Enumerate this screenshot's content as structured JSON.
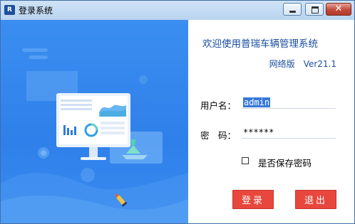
{
  "window": {
    "title": "登录系统",
    "icon_glyph": "R",
    "close_glyph": "✕"
  },
  "header": {
    "welcome": "欢迎使用普瑞车辆管理系统",
    "edition": "网络版",
    "version": "Ver21.1"
  },
  "form": {
    "username_label": "用户名：",
    "username_value": "admin",
    "password_label": "密　码：",
    "password_value": "******",
    "remember_label": "是否保存密码",
    "remember_checked": false
  },
  "buttons": {
    "login": "登录",
    "exit": "退出"
  },
  "colors": {
    "accent_blue": "#2f80ea",
    "button_red": "#e8473d",
    "title_blue": "#1a4ea0"
  },
  "icons": {
    "window": "app-logo-icon",
    "minimize": "minimize-icon",
    "maximize": "maximize-icon",
    "close": "close-icon",
    "illustration": "dashboard-monitor-illustration"
  }
}
